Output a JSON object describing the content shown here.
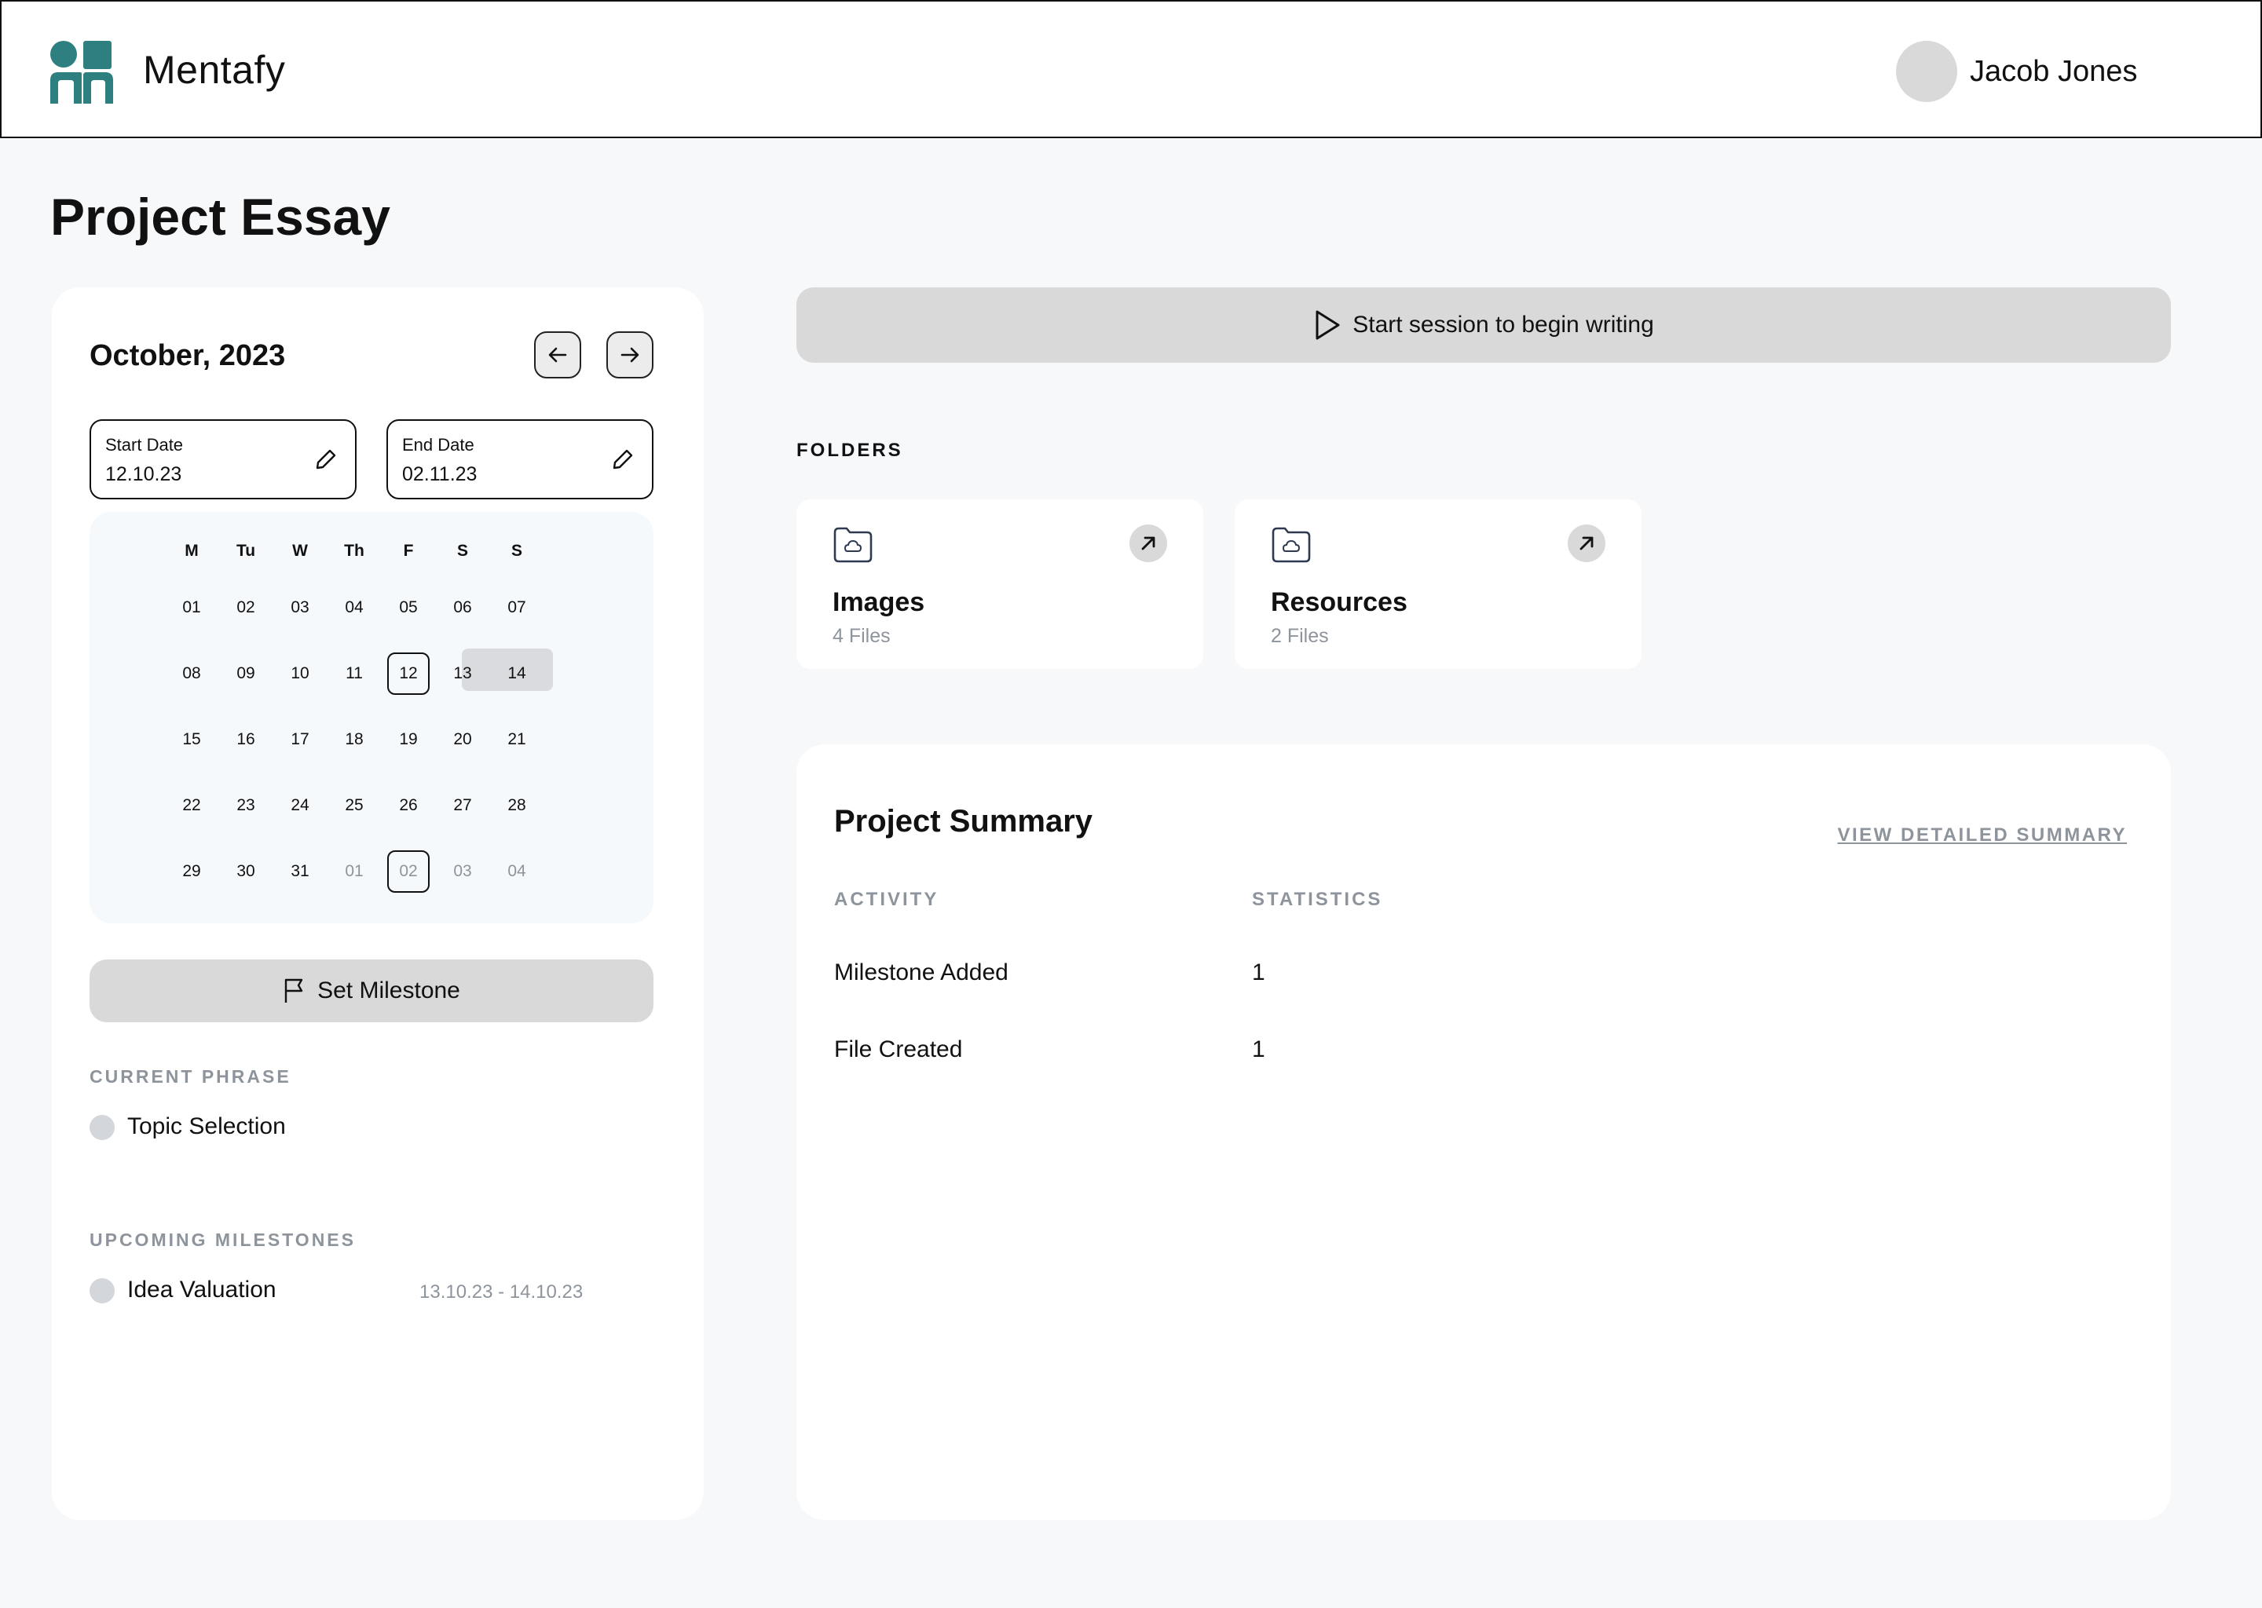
{
  "header": {
    "brand": "Mentafy",
    "user_name": "Jacob Jones"
  },
  "page": {
    "title": "Project Essay"
  },
  "calendar": {
    "month": "October, 2023",
    "start_label": "Start Date",
    "start_value": "12.10.23",
    "end_label": "End Date",
    "end_value": "02.11.23",
    "weekdays": [
      "M",
      "Tu",
      "W",
      "Th",
      "F",
      "S",
      "S"
    ],
    "weeks": [
      [
        "01",
        "02",
        "03",
        "04",
        "05",
        "06",
        "07"
      ],
      [
        "08",
        "09",
        "10",
        "11",
        "12",
        "13",
        "14"
      ],
      [
        "15",
        "16",
        "17",
        "18",
        "19",
        "20",
        "21"
      ],
      [
        "22",
        "23",
        "24",
        "25",
        "26",
        "27",
        "28"
      ],
      [
        "29",
        "30",
        "31",
        "01",
        "02",
        "03",
        "04"
      ]
    ]
  },
  "milestone_button": "Set Milestone",
  "current_phase": {
    "label": "CURRENT PHRASE",
    "item": "Topic Selection"
  },
  "upcoming": {
    "label": "UPCOMING MILESTONES",
    "item": "Idea Valuation",
    "range": "13.10.23 - 14.10.23"
  },
  "session_button": "Start session to begin writing",
  "folders": {
    "label": "FOLDERS",
    "items": [
      {
        "name": "Images",
        "count": "4 Files"
      },
      {
        "name": "Resources",
        "count": "2 Files"
      }
    ]
  },
  "summary": {
    "title": "Project Summary",
    "link": "VIEW DETAILED SUMMARY",
    "col_activity": "ACTIVITY",
    "col_statistics": "STATISTICS",
    "rows": [
      {
        "activity": "Milestone Added",
        "value": "1"
      },
      {
        "activity": "File Created",
        "value": "1"
      }
    ]
  },
  "colors": {
    "brand": "#2e8080",
    "button_gray": "#d9d9d9",
    "muted_text": "#8e949c"
  },
  "icons": [
    "logo",
    "arrow-left-icon",
    "arrow-right-icon",
    "pencil-icon",
    "flag-icon",
    "play-icon",
    "folder-cloud-icon",
    "arrow-up-right-icon"
  ]
}
